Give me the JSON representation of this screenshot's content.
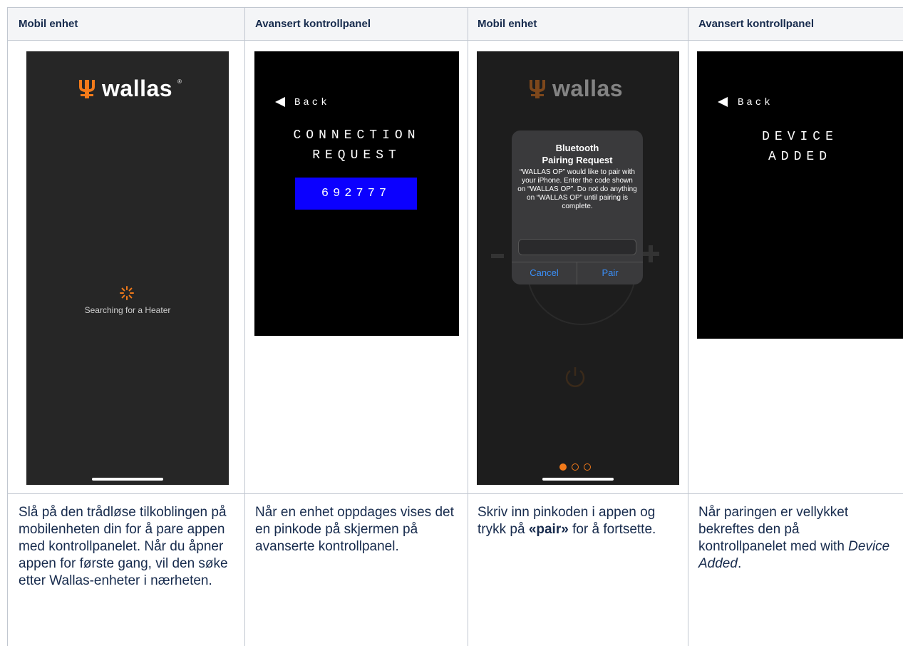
{
  "columns": [
    {
      "header": "Mobil enhet",
      "description_parts": [
        {
          "text": "Slå på den trådløse tilkoblingen på mobilenheten din for å pare appen med kontrollpanelet. Når du åpner appen for første gang, vil den søke etter Wallas-enheter i nærheten.",
          "style": "normal"
        }
      ]
    },
    {
      "header": "Avansert kontrollpanel",
      "description_parts": [
        {
          "text": "Når en enhet oppdages vises det en pinkode på skjermen på avanserte kontrollpanel.",
          "style": "normal"
        }
      ]
    },
    {
      "header": "Mobil enhet",
      "description_parts": [
        {
          "text": "Skriv inn pinkoden i appen og trykk på ",
          "style": "normal"
        },
        {
          "text": "«pair»",
          "style": "bold"
        },
        {
          "text": " for å fortsette.",
          "style": "normal"
        }
      ]
    },
    {
      "header": "Avansert kontrollpanel",
      "description_parts": [
        {
          "text": "Når paringen er vellykket bekreftes den på kontrollpanelet med with ",
          "style": "normal"
        },
        {
          "text": "Device Added",
          "style": "italic"
        },
        {
          "text": ".",
          "style": "normal"
        }
      ]
    }
  ],
  "screen1": {
    "brand": "wallas",
    "reg": "®",
    "status": "Searching for a Heater",
    "icon": "spinner-icon"
  },
  "screen2": {
    "back_label": "Back",
    "title_line1": "CONNECTION",
    "title_line2": "REQUEST",
    "pin": "692777",
    "pin_bg": "#0b00ff"
  },
  "screen3": {
    "brand": "wallas",
    "reg": "®",
    "dialog_title_line1": "Bluetooth",
    "dialog_title_line2": "Pairing Request",
    "dialog_message": "“WALLAS OP” would like to pair with your iPhone. Enter the code shown on “WALLAS OP”. Do not do anything on “WALLAS OP” until pairing is complete.",
    "cancel_label": "Cancel",
    "pair_label": "Pair",
    "input_value": "",
    "page_dots": {
      "count": 3,
      "active": 1
    },
    "accent": "#f27a1a",
    "link_color": "#3a8ef6"
  },
  "screen4": {
    "back_label": "Back",
    "title_line1": "DEVICE",
    "title_line2": "ADDED"
  }
}
